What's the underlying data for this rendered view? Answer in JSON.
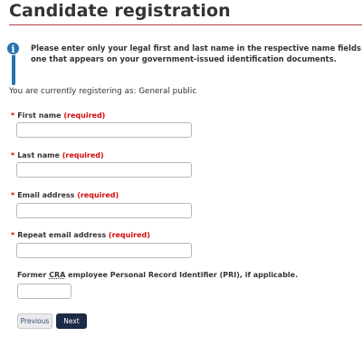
{
  "page": {
    "title": "Candidate registration"
  },
  "notice": {
    "icon": "info-icon",
    "line1": "Please enter only your legal first and last name in the respective name fields. Your legal name is the",
    "line2": "one that appears on your government-issued identification documents."
  },
  "registering_as": "You are currently registering as: General public",
  "form": {
    "required_marker": "*",
    "required_text": "(required)",
    "first_name": {
      "label": "First name",
      "value": ""
    },
    "last_name": {
      "label": "Last name",
      "value": ""
    },
    "email": {
      "label": "Email address",
      "value": ""
    },
    "email_repeat": {
      "label": "Repeat email address",
      "value": ""
    },
    "pri": {
      "label_prefix": "Former",
      "label_abbr": "CRA",
      "label_suffix": "employee Personal Record Identifier (PRI), if applicable.",
      "value": ""
    }
  },
  "buttons": {
    "previous": "Previous",
    "next": "Next"
  },
  "colors": {
    "title_rule": "#af3c43",
    "required": "#d3080c",
    "info": "#2572b4",
    "primary_button": "#1c2b46"
  }
}
